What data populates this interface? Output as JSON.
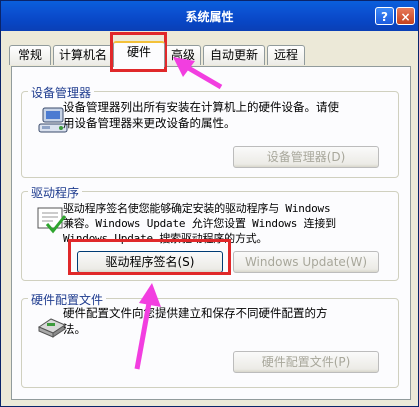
{
  "window": {
    "title": "系统属性",
    "help": "?",
    "close": "×"
  },
  "tabs": [
    {
      "label": "常规"
    },
    {
      "label": "计算机名"
    },
    {
      "label": "硬件"
    },
    {
      "label": "高级"
    },
    {
      "label": "自动更新"
    },
    {
      "label": "远程"
    }
  ],
  "device_manager": {
    "title": "设备管理器",
    "line1": "设备管理器列出所有安装在计算机上的硬件设备。请使",
    "line2": "用设备管理器来更改设备的属性。",
    "button": "设备管理器(D)"
  },
  "drivers": {
    "title": "驱动程序",
    "line1": "驱动程序签名使您能够确定安装的驱动程序与 Windows",
    "line2": "兼容。Windows Update 允许您设置 Windows 连接到",
    "line3": "Windows Update 搜索驱动程序的方式。",
    "sign_button": "驱动程序签名(S)",
    "update_button": "Windows Update(W)"
  },
  "hw_profiles": {
    "title": "硬件配置文件",
    "line1": "硬件配置文件向您提供建立和保存不同硬件配置的方",
    "line2": "法。",
    "button": "硬件配置文件(P)"
  },
  "colors": {
    "highlight": "#e0282a",
    "arrow": "#f23ee0",
    "title_text": "#1f3c8f"
  }
}
